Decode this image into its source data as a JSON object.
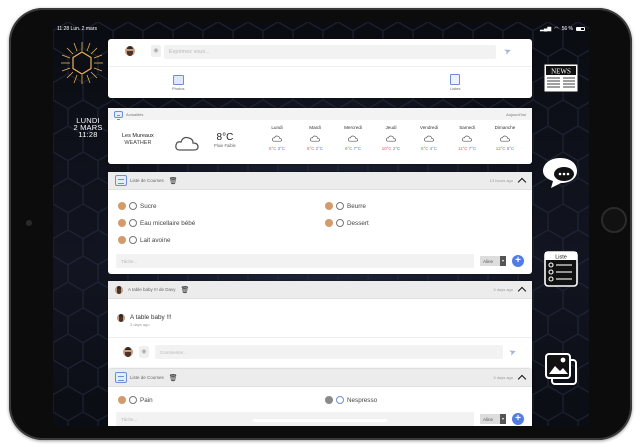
{
  "status": {
    "time": "11:28",
    "date": "Lun. 2 mars",
    "battery": "56 %"
  },
  "sidebar_date": {
    "day": "LUNDI",
    "date": "2 MARS",
    "time": "11:28"
  },
  "composer": {
    "placeholder": "Exprimez vous...",
    "photos_label": "Photos",
    "lists_label": "Listes"
  },
  "weather": {
    "header": "Actualités",
    "header_right": "Aujourd'hui",
    "city": "Les Mureaux",
    "subtitle": "WEATHER",
    "temp": "8°C",
    "condition": "Pluie Faible",
    "days": [
      {
        "name": "Lundi",
        "hi": "6°C",
        "lo": "3°C"
      },
      {
        "name": "Mardi",
        "hi": "6°C",
        "lo": "2°C"
      },
      {
        "name": "Mercredi",
        "hi": "6°C",
        "lo": "7°C"
      },
      {
        "name": "Jeudi",
        "hi": "10°C",
        "lo": "2°C"
      },
      {
        "name": "Vendredi",
        "hi": "6°C",
        "lo": "4°C"
      },
      {
        "name": "Samedi",
        "hi": "11°C",
        "lo": "7°C"
      },
      {
        "name": "Dimanche",
        "hi": "12°C",
        "lo": "5°C"
      }
    ]
  },
  "list1": {
    "title": "Liste de Courses",
    "time": "13 hours ago",
    "items_left": [
      "Sucre",
      "Eau micellaire bébé",
      "Lait avoine"
    ],
    "items_right": [
      "Beurre",
      "Dessert"
    ],
    "input_placeholder": "Tâche...",
    "select_value": "Aline"
  },
  "post": {
    "title": "A table baby !!! de Davy",
    "time": "3 days ago",
    "text": "A table baby !!!",
    "sub_time": "3 days ago",
    "comment_placeholder": "Commenter..."
  },
  "list2": {
    "title": "Liste de Courses",
    "time": "3 days ago",
    "item_left": "Pain",
    "item_right": "Nespresso",
    "input_placeholder": "Tâche...",
    "select_value": "Aline"
  },
  "side_icons": {
    "news": "NEWS",
    "list": "Liste"
  },
  "icons": [
    "news-icon",
    "chat-icon",
    "list-icon",
    "gallery-icon",
    "send-icon",
    "camera-icon",
    "trash-icon",
    "cloud-icon",
    "chevron-up-icon",
    "plus-icon"
  ]
}
